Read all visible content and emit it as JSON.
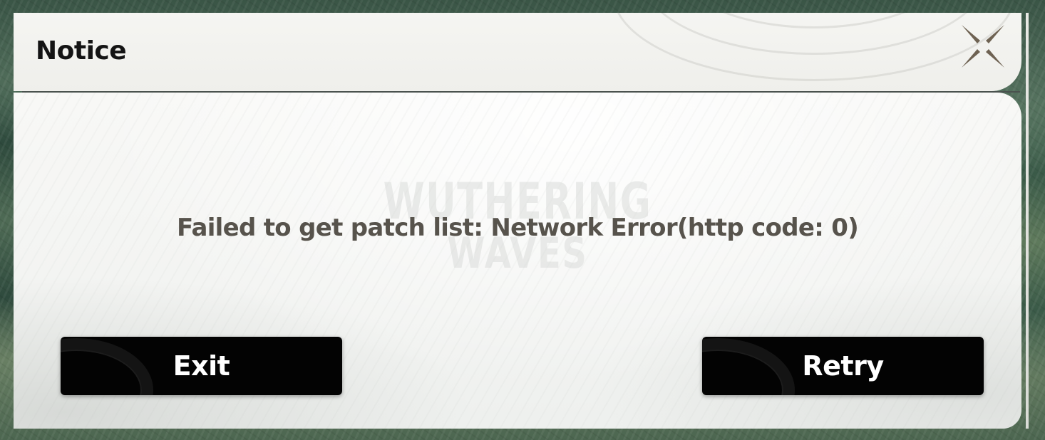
{
  "dialog": {
    "title": "Notice",
    "close_icon": "close-icon",
    "message": "Failed to get patch list: Network Error(http code: 0)",
    "watermark": [
      "WUTHERING",
      "WAVES"
    ]
  },
  "buttons": {
    "exit_label": "Exit",
    "retry_label": "Retry"
  },
  "colors": {
    "button_bg": "#030303",
    "button_text": "#ffffff",
    "message_text": "#57534c",
    "title_text": "#141414",
    "close_icon": "#6e6252",
    "dialog_bg": "#f4f4f2"
  }
}
